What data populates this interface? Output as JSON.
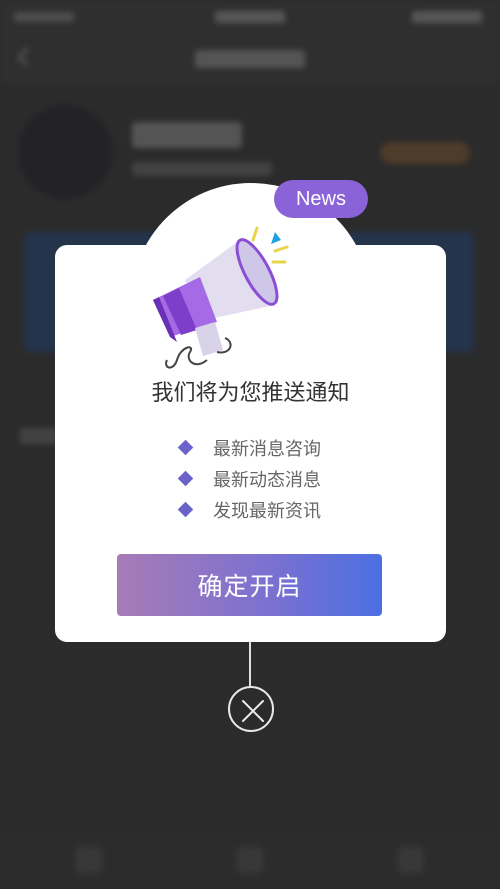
{
  "modal": {
    "badge": "News",
    "title": "我们将为您推送通知",
    "features": [
      "最新消息咨询",
      "最新动态消息",
      "发现最新资讯"
    ],
    "confirm_label": "确定开启"
  },
  "icons": {
    "megaphone": "megaphone-icon",
    "bullet": "diamond-icon",
    "close": "close-icon"
  },
  "colors": {
    "accent": "#8a63d8",
    "bullet": "#6b63c9",
    "button_start": "#a77bb6",
    "button_end": "#4c6fe2"
  }
}
